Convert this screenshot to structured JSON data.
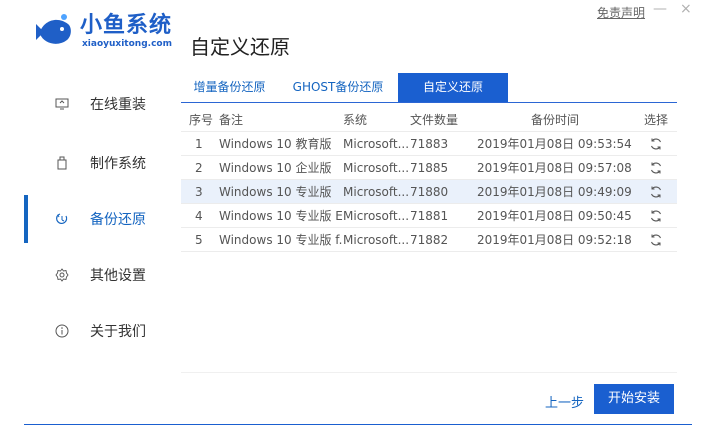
{
  "brand": {
    "name_cn": "小鱼系统",
    "name_en": "xiaoyuxitong.com"
  },
  "page_title": "自定义还原",
  "disclaimer": "免责声明",
  "window": {
    "minimize": "—",
    "close": "×"
  },
  "sidebar": {
    "items": [
      {
        "label": "在线重装",
        "icon": "monitor-icon",
        "active": false
      },
      {
        "label": "制作系统",
        "icon": "usb-icon",
        "active": false
      },
      {
        "label": "备份还原",
        "icon": "backup-icon",
        "active": true
      },
      {
        "label": "其他设置",
        "icon": "gear-icon",
        "active": false
      },
      {
        "label": "关于我们",
        "icon": "info-icon",
        "active": false
      }
    ]
  },
  "tabs": [
    {
      "label": "增量备份还原"
    },
    {
      "label": "GHOST备份还原"
    },
    {
      "label": "自定义还原",
      "active": true
    }
  ],
  "table": {
    "headers": {
      "no": "序号",
      "note": "备注",
      "sys": "系统",
      "count": "文件数量",
      "time": "备份时间",
      "pick": "选择"
    },
    "rows": [
      {
        "no": "1",
        "note": "Windows 10 教育版",
        "sys": "Microsoft...",
        "count": "71883",
        "time": "2019年01月08日 09:53:54"
      },
      {
        "no": "2",
        "note": "Windows 10 企业版",
        "sys": "Microsoft...",
        "count": "71885",
        "time": "2019年01月08日 09:57:08"
      },
      {
        "no": "3",
        "note": "Windows 10 专业版",
        "sys": "Microsoft...",
        "count": "71880",
        "time": "2019年01月08日 09:49:09"
      },
      {
        "no": "4",
        "note": "Windows 10 专业版 E...",
        "sys": "Microsoft...",
        "count": "71881",
        "time": "2019年01月08日 09:50:45"
      },
      {
        "no": "5",
        "note": "Windows 10 专业版 f...",
        "sys": "Microsoft...",
        "count": "71882",
        "time": "2019年01月08日 09:52:18"
      }
    ]
  },
  "actions": {
    "prev": "上一步",
    "start": "开始安装"
  },
  "colors": {
    "accent": "#1a5fd0",
    "brand": "#1f5fc7",
    "selected_row": "#eaf1fb"
  }
}
